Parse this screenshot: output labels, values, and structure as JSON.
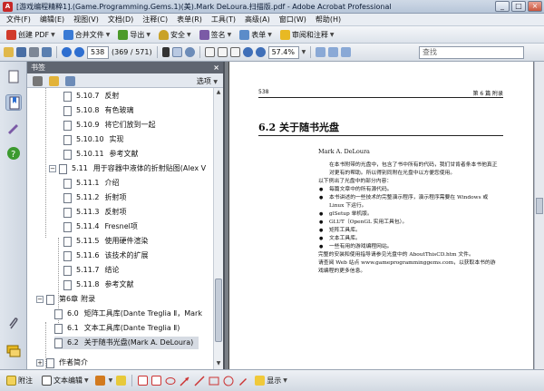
{
  "window": {
    "title": "[游戏编程精粹1].(Game.Programming.Gems.1)(美).Mark DeLoura.扫描版.pdf - Adobe Acrobat Professional",
    "app_icon": "A",
    "controls": [
      "_",
      "□",
      "×"
    ]
  },
  "menu": [
    "文件(F)",
    "编辑(E)",
    "视图(V)",
    "文档(D)",
    "注释(C)",
    "表单(R)",
    "工具(T)",
    "高级(A)",
    "窗口(W)",
    "帮助(H)"
  ],
  "toolbar1": {
    "create_pdf": "创建 PDF",
    "combine": "合并文件",
    "export": "导出",
    "secure": "安全",
    "sign": "签名",
    "forms": "表单",
    "review": "审阅和注释"
  },
  "toolbar2": {
    "page_number": "538",
    "page_count": "(369 / 571)",
    "zoom": "57.4%",
    "search_placeholder": "查找"
  },
  "nav_panel": {
    "title": "书签",
    "close": "×",
    "options": "选项",
    "items": [
      {
        "num": "5.10.7",
        "label": "反射"
      },
      {
        "num": "5.10.8",
        "label": "有色玻璃"
      },
      {
        "num": "5.10.9",
        "label": "将它们放到一起"
      },
      {
        "num": "5.10.10",
        "label": "实现"
      },
      {
        "num": "5.10.11",
        "label": "参考文献"
      },
      {
        "num": "5.11",
        "label": "用于容器中液体的折射贴图(Alex V"
      },
      {
        "num": "5.11.1",
        "label": "介绍"
      },
      {
        "num": "5.11.2",
        "label": "折射项"
      },
      {
        "num": "5.11.3",
        "label": "反射项"
      },
      {
        "num": "5.11.4",
        "label": "Fresnel项"
      },
      {
        "num": "5.11.5",
        "label": "使用硬件渲染"
      },
      {
        "num": "5.11.6",
        "label": "该技术的扩展"
      },
      {
        "num": "5.11.7",
        "label": "结论"
      },
      {
        "num": "5.11.8",
        "label": "参考文献"
      },
      {
        "num": "第6章",
        "label": "附录"
      },
      {
        "num": "6.0",
        "label": "矩阵工具库(Dante Treglia Ⅱ，Mark"
      },
      {
        "num": "6.1",
        "label": "文本工具库(Dante Treglia Ⅱ)"
      },
      {
        "num": "6.2",
        "label": "关于随书光盘(Mark A. DeLoura)"
      }
    ],
    "partial_last": "作者简介"
  },
  "document": {
    "header_left": "538",
    "header_right": "第 6 篇   附录",
    "section_title": "6.2   关于随书光盘",
    "author": "Mark A. DeLoura",
    "paragraph1": "在本书附带的光盘中，包含了书中所有的代码，我们甘肯者条本书他真正对更有的帮助。所以得别同附在光盘中以方便您使用。",
    "intro": "以下例出了光盘中的部分内容：",
    "bullets": [
      "每篇文章中的所有源代码。",
      "本书讲述的一些技术的完整演示程序，演示程序需要在 Windows 或 Linux 下运行。",
      "glSetup 单机版。",
      "GLUT（OpenGL 实用工具包）。",
      "矩阵工具库。",
      "文本工具库。",
      "一些有用的游戏编程网站。"
    ],
    "paragraph2": "完整的安装和使用指导请参见光盘中的 AboutThisCD.htm 文件。",
    "paragraph3": "请查阅 Web 站点 www.gameprogramminggems.com，以获取本书的游戏编程的更多信息。"
  },
  "bottom_toolbar": {
    "comment": "附注",
    "text_edit": "文本编辑",
    "show": "显示"
  },
  "colors": {
    "title_bar": "#c3d0e0",
    "panel_header": "#5f6570",
    "document_bg": "#7a7f86",
    "accent_red": "#c62828"
  }
}
